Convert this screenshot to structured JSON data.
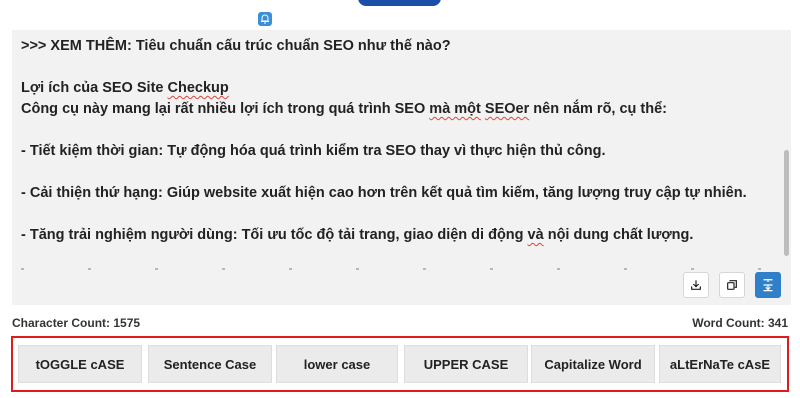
{
  "editor": {
    "lines": [
      ">>> XEM THÊM: Tiêu chuẩn cấu trúc chuẩn SEO như thế nào?",
      "",
      "Lợi ích của SEO Site Checkup",
      "Công cụ này mang lại rất nhiều lợi ích trong quá trình SEO mà một SEOer nên nắm rõ, cụ thể:",
      "",
      "- Tiết kiệm thời gian: Tự động hóa quá trình kiểm tra SEO thay vì thực hiện thủ công.",
      "",
      "- Cải thiện thứ hạng: Giúp website xuất hiện cao hơn trên kết quả tìm kiếm, tăng lượng truy cập tự nhiên.",
      "",
      "- Tăng trải nghiệm người dùng: Tối ưu tốc độ tải trang, giao diện di động và nội dung chất lượng."
    ]
  },
  "toolbar": {
    "download_icon": "download-icon",
    "copy_icon": "copy-icon",
    "format_icon": "text-align-icon",
    "active_color": "#2f80c8"
  },
  "counts": {
    "character": "Character Count: 1575",
    "word": "Word Count: 341"
  },
  "case_buttons": {
    "toggle": "tOGGLE cASE",
    "sentence": "Sentence Case",
    "lower": "lower case",
    "upper": "UPPER CASE",
    "capitalize": "Capitalize Word",
    "alternate": "aLtErNaTe cAsE"
  },
  "colors": {
    "highlight_border": "#e01b1b",
    "brand": "#1b4ea8"
  }
}
